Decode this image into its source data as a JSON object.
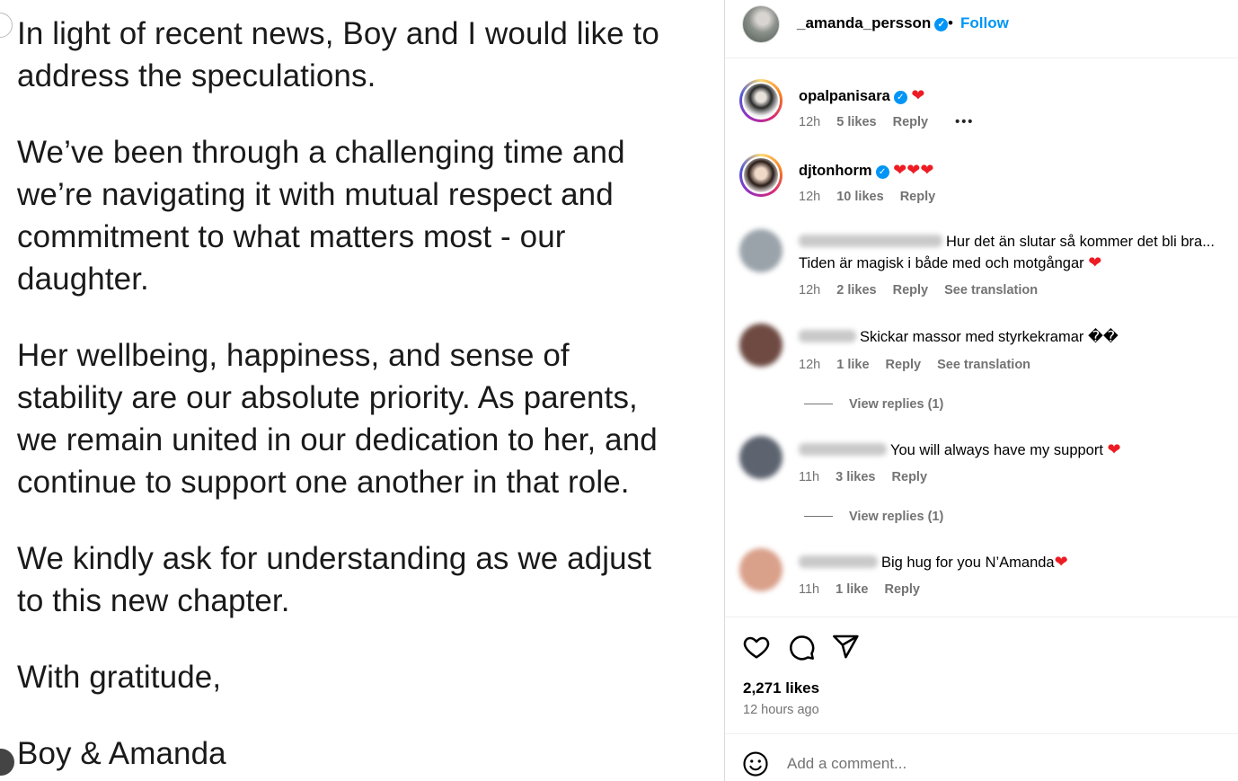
{
  "post": {
    "paragraphs": [
      "In light of recent news, Boy and I would like to address the speculations.",
      "We’ve been through a challenging time and we’re navigating it with mutual respect and commitment to what matters most - our daughter.",
      "Her wellbeing, happiness, and sense of stability are our absolute priority. As parents, we remain united in our dedication to her, and continue to support one another in that role.",
      "We kindly ask for understanding as we adjust to this new chapter.",
      "With gratitude,",
      "Boy & Amanda"
    ]
  },
  "header": {
    "username": "_amanda_persson",
    "separator": "•",
    "follow_label": "Follow"
  },
  "comments": [
    {
      "user": "opalpanisara",
      "verified": true,
      "text": "❤",
      "time": "12h",
      "likes": "5 likes",
      "reply": "Reply",
      "more": "•••"
    },
    {
      "user": "djtonhorm",
      "verified": true,
      "text": "❤❤❤",
      "time": "12h",
      "likes": "10 likes",
      "reply": "Reply"
    },
    {
      "user": "",
      "text": "Hur det än slutar så kommer det bli bra... Tiden är magisk i både med och motgångar",
      "heart": "❤",
      "time": "12h",
      "likes": "2 likes",
      "reply": "Reply",
      "translate": "See translation"
    },
    {
      "user": "",
      "text": "Skickar massor med styrkekramar ��",
      "time": "12h",
      "likes": "1 like",
      "reply": "Reply",
      "translate": "See translation",
      "view_replies": "View replies (1)"
    },
    {
      "user": "",
      "text": "You will always have my support",
      "heart": "❤",
      "time": "11h",
      "likes": "3 likes",
      "reply": "Reply",
      "view_replies": "View replies (1)"
    },
    {
      "user": "",
      "text": "Big hug for you N’Amanda",
      "heart": "❤",
      "time": "11h",
      "likes": "1 like",
      "reply": "Reply"
    }
  ],
  "footer": {
    "likes": "2,271 likes",
    "time_ago": "12 hours ago",
    "comment_placeholder": "Add a comment..."
  },
  "icons": {
    "like": "heart-icon",
    "comment": "comment-icon",
    "share": "share-icon",
    "emoji": "emoji-icon",
    "verified": "verified-badge-icon"
  },
  "colors": {
    "accent": "#0095f6",
    "heart": "#ed1c24",
    "muted": "#737373"
  }
}
